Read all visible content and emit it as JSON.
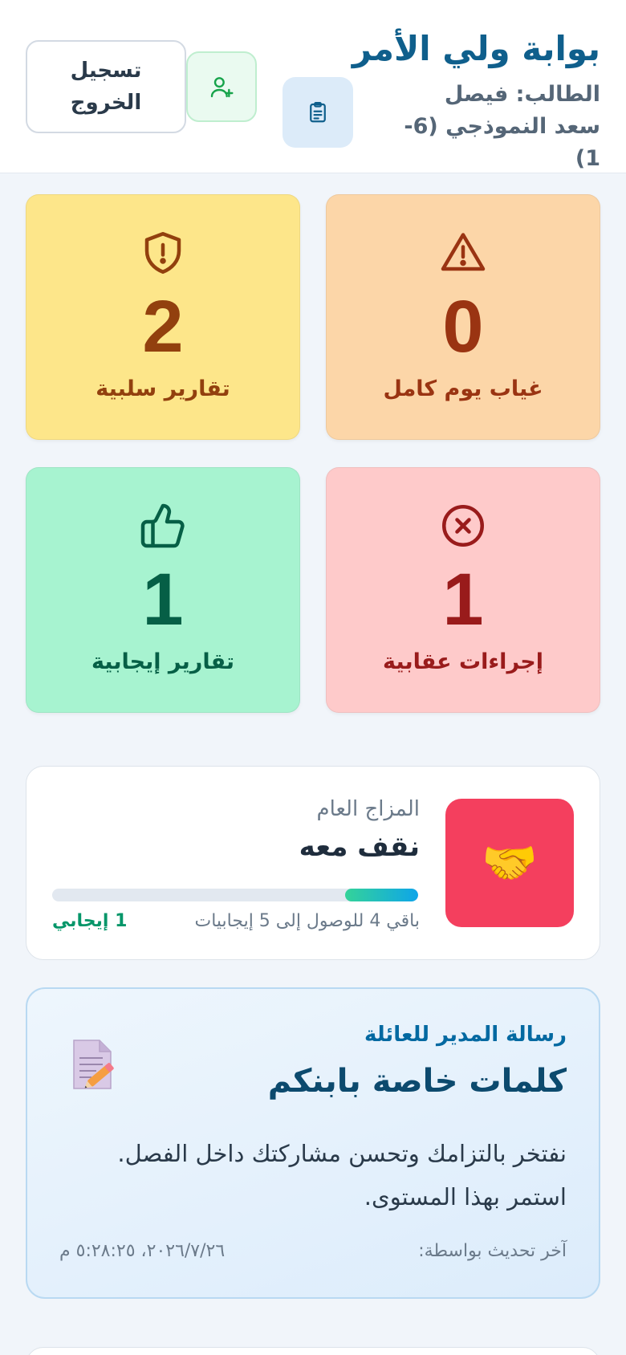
{
  "header": {
    "title": "بوابة ولي الأمر",
    "student_line": "الطالب: فيصل سعد النموذجي (6-1)",
    "logout_label": "تسجيل الخروج",
    "report_icon": "clipboard-icon",
    "add_user_icon": "user-plus-icon"
  },
  "stats": {
    "absence": {
      "value": "0",
      "label": "غياب يوم كامل",
      "icon": "warning-triangle-icon",
      "color": "#9a3412",
      "bg": "#fcd6a8"
    },
    "negative": {
      "value": "2",
      "label": "تقارير سلبية",
      "icon": "shield-alert-icon",
      "color": "#92400e",
      "bg": "#fde68a"
    },
    "penalty": {
      "value": "1",
      "label": "إجراءات عقابية",
      "icon": "x-circle-icon",
      "color": "#991b1b",
      "bg": "#fecaca"
    },
    "positive": {
      "value": "1",
      "label": "تقارير إيجابية",
      "icon": "thumbs-up-icon",
      "color": "#065f46",
      "bg": "#a7f3d0"
    }
  },
  "mood": {
    "label": "المزاج العام",
    "title": "نقف معه",
    "emoji": "🤝",
    "icon": "handshake-icon",
    "progress_fraction": 0.2,
    "remaining_text": "باقي 4 للوصول إلى 5 إيجابيات",
    "count_text": "1 إيجابي"
  },
  "message": {
    "subtitle": "رسالة المدير للعائلة",
    "title": "كلمات خاصة بابنكم",
    "icon": "memo-pencil-icon",
    "body": "نفتخر بالتزامك وتحسن مشاركتك داخل الفصل. استمر بهذا المستوى.",
    "footer_label": "آخر تحديث بواسطة:",
    "footer_date": "٢٠٢٦/٧/٢٦، ٥:٢٨:٢٥ م"
  }
}
